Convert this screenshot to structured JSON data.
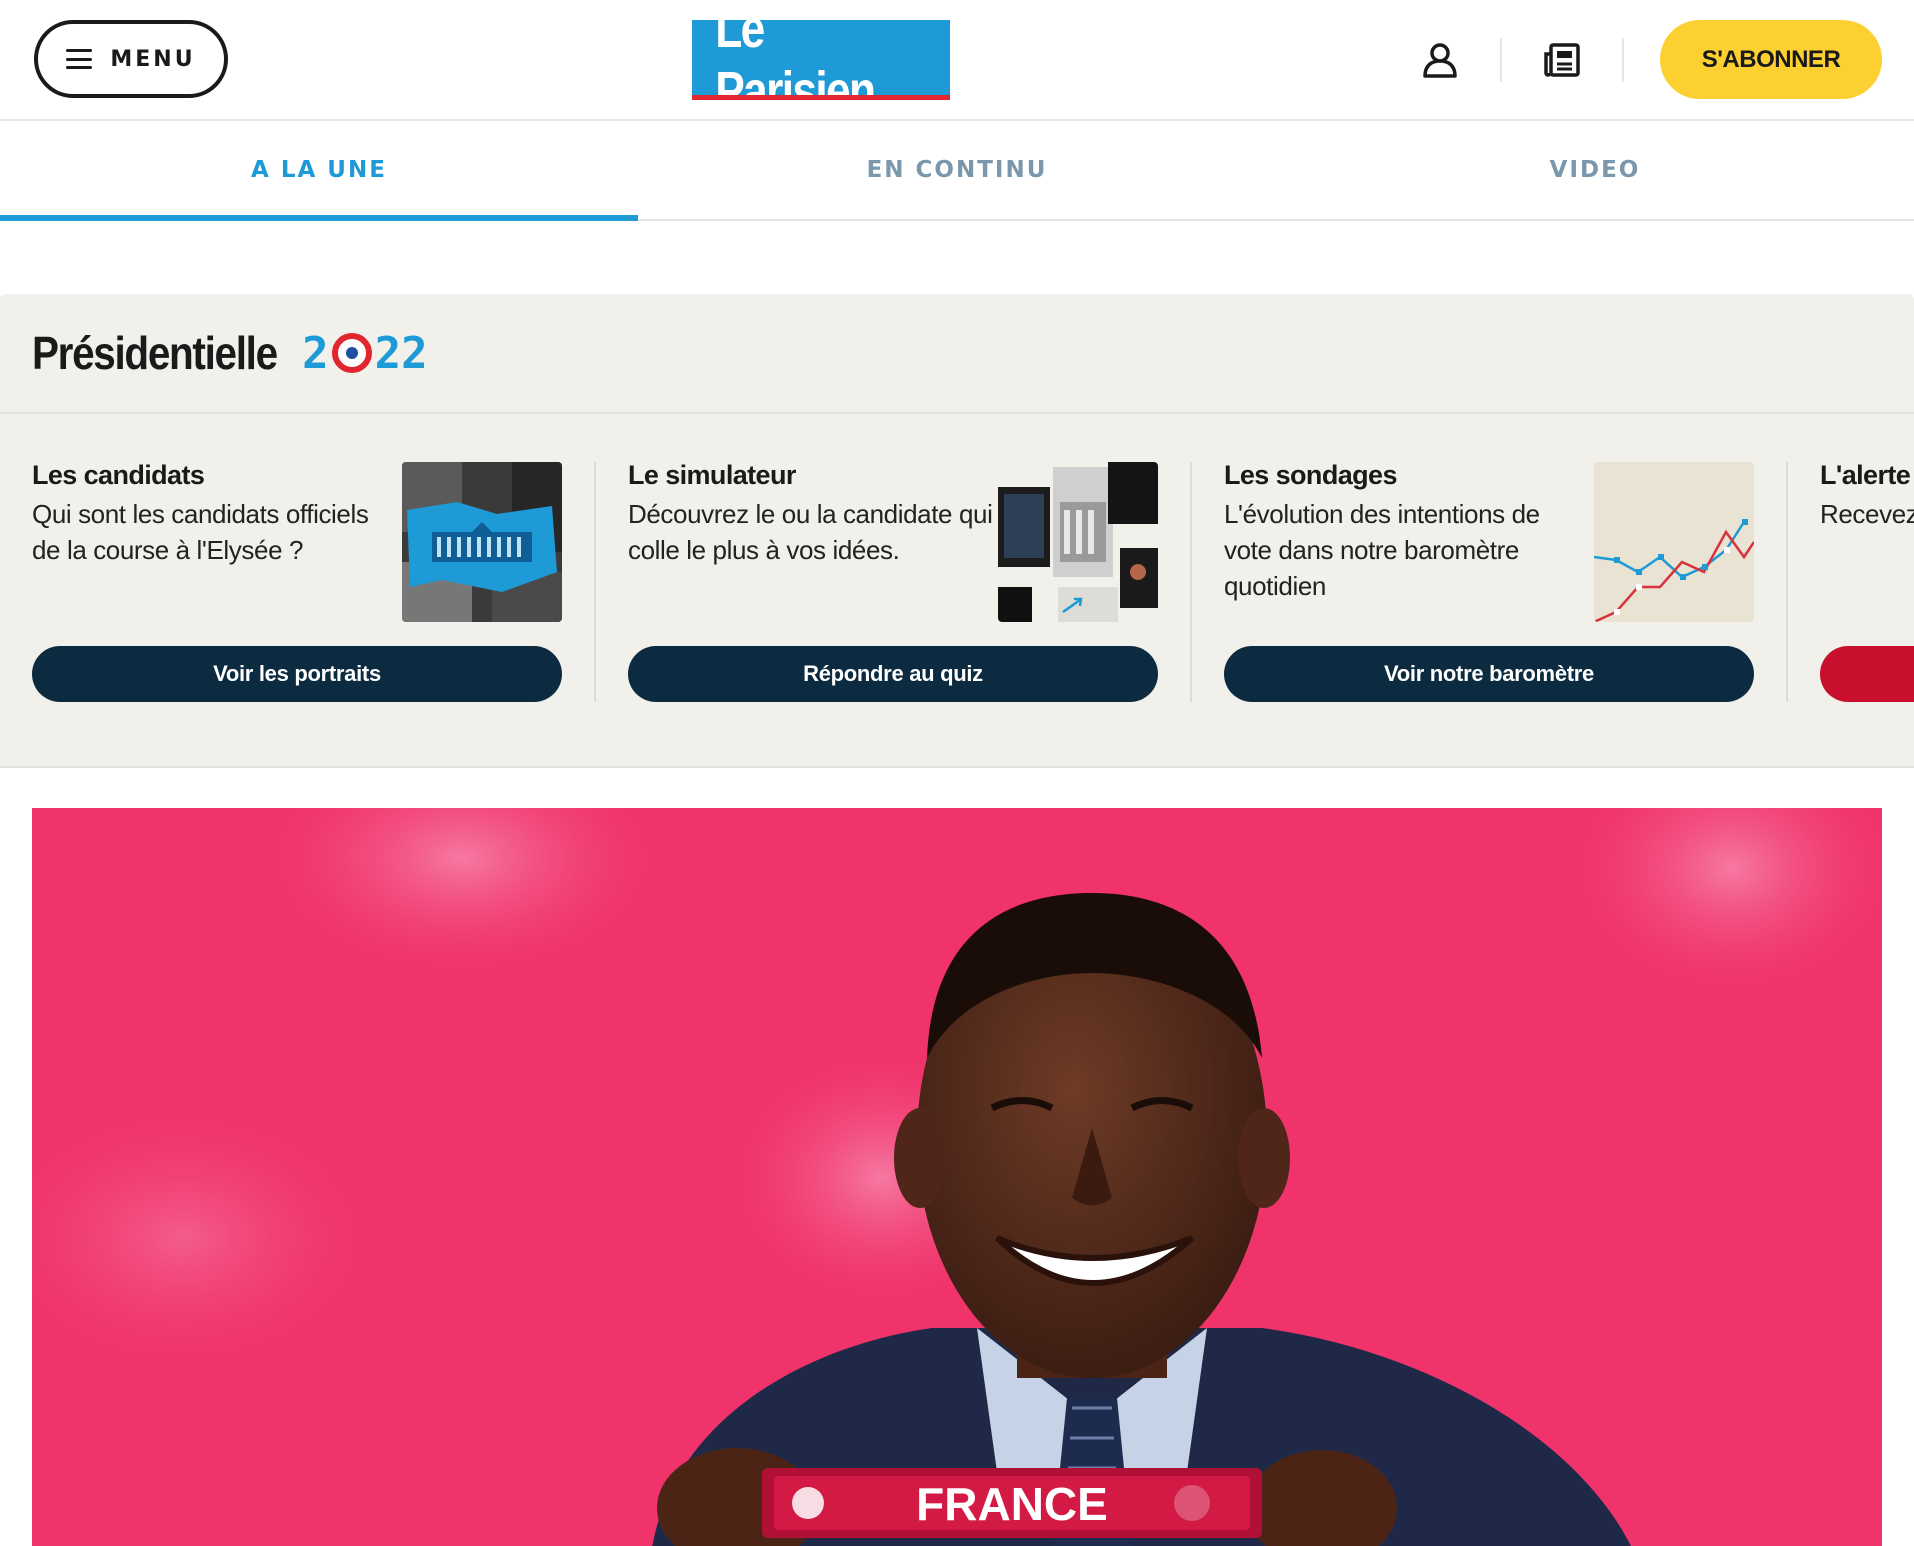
{
  "header": {
    "menu_label": "MENU",
    "logo_text": "Le Parisien",
    "subscribe_label": "S'ABONNER",
    "icons": [
      "user-icon",
      "newspaper-icon"
    ]
  },
  "tabs": [
    {
      "label": "A LA UNE",
      "active": true
    },
    {
      "label": "EN CONTINU",
      "active": false
    },
    {
      "label": "VIDEO",
      "active": false
    }
  ],
  "presidential": {
    "title": "Présidentielle",
    "year_prefix": "2",
    "year_suffix": "22",
    "cards": [
      {
        "title": "Les candidats",
        "description": "Qui sont les candidats officiels de la course à l'Elysée ?",
        "cta": "Voir les portraits"
      },
      {
        "title": "Le simulateur",
        "description": "Découvrez le ou la candidate qui colle le plus à vos idées.",
        "cta": "Répondre au quiz"
      },
      {
        "title": "Les sondages",
        "description": "L'évolution des intentions de vote dans notre baromètre quotidien",
        "cta": "Voir notre baromètre"
      },
      {
        "title": "L'alerte r",
        "description": "Recevez votre bo",
        "cta": ""
      }
    ]
  },
  "hero": {
    "banner_text": "FRANCE"
  },
  "colors": {
    "brand_blue": "#1e9ad6",
    "brand_red": "#e2262f",
    "subscribe_yellow": "#fdd032",
    "navy": "#0d2b40",
    "block_bg": "#f1f0eb",
    "hero_pink": "#f0336a"
  }
}
